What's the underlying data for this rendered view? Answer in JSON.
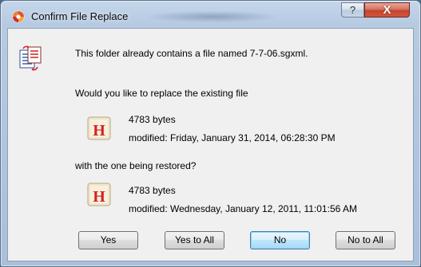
{
  "window": {
    "title": "Confirm File Replace",
    "help_glyph": "?",
    "close_glyph": "X",
    "title_icon": "app-swirl-icon"
  },
  "dialog": {
    "message": "This folder already contains a file named 7-7-06.sgxml.",
    "question": "Would you like to replace the existing file",
    "existing_file": {
      "size": "4783 bytes",
      "modified": "modified: Friday, January 31, 2014, 06:28:30 PM",
      "icon": "h-file-icon"
    },
    "with_text": "with the one being restored?",
    "restored_file": {
      "size": "4783 bytes",
      "modified": "modified: Wednesday, January 12, 2011, 11:01:56 AM",
      "icon": "h-file-icon"
    },
    "main_icon": "file-replace-icon"
  },
  "buttons": {
    "yes": "Yes",
    "yes_to_all": "Yes to All",
    "no": "No",
    "no_to_all": "No to All"
  },
  "colors": {
    "titlebar": "#b6cae2",
    "close_button": "#c4442d",
    "default_button_border": "#3c7fb1",
    "file_icon_letter": "#d42222"
  }
}
